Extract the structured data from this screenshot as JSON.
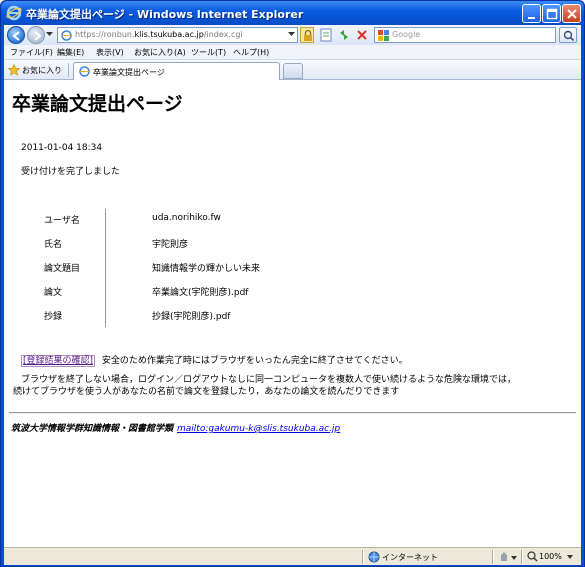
{
  "window": {
    "title": "卒業論文提出ページ - Windows Internet Explorer"
  },
  "address_bar": {
    "url_prefix": "https://ronbun.",
    "url_host": "klis.tsukuba.ac.jp",
    "url_path": "/index.cgi"
  },
  "search": {
    "placeholder": "Google"
  },
  "menu": [
    "ファイル(F)",
    "編集(E)",
    "表示(V)",
    "お気に入り(A)",
    "ツール(T)",
    "ヘルプ(H)"
  ],
  "favorites": {
    "label": "お気に入り"
  },
  "tab": {
    "label": "卒業論文提出ページ"
  },
  "page": {
    "heading": "卒業論文提出ページ",
    "timestamp": "2011-01-04 18:34",
    "message": "受け付けを完了しました",
    "info": [
      {
        "key": "ユーザ名",
        "value": "uda.norihiko.fw"
      },
      {
        "key": "氏名",
        "value": "宇陀則彦"
      },
      {
        "key": "論文題目",
        "value": "知識情報学の輝かしい未来"
      },
      {
        "key": "論文",
        "value": "卒業論文(宇陀則彦).pdf"
      },
      {
        "key": "抄録",
        "value": "抄録(宇陀則彦).pdf"
      }
    ],
    "confirm_link": "[登録結果の確認]",
    "confirm_note": "安全のため作業完了時にはブラウザをいったん完全に終了させてください。",
    "warning_line1": "ブラウザを終了しない場合，ログイン／ログアウトなしに同一コンピュータを複数人で使い続けるような危険な環境では，",
    "warning_line2": "続けてブラウザを使う人があなたの名前で論文を登録したり，あなたの論文を読んだりできます",
    "footer_org": "筑波大学情報学群知識情報・図書館学類",
    "footer_link": "mailto:gakumu-k@slis.tsukuba.ac.jp"
  },
  "status_bar": {
    "zone": "インターネット",
    "zoom": "100%"
  }
}
